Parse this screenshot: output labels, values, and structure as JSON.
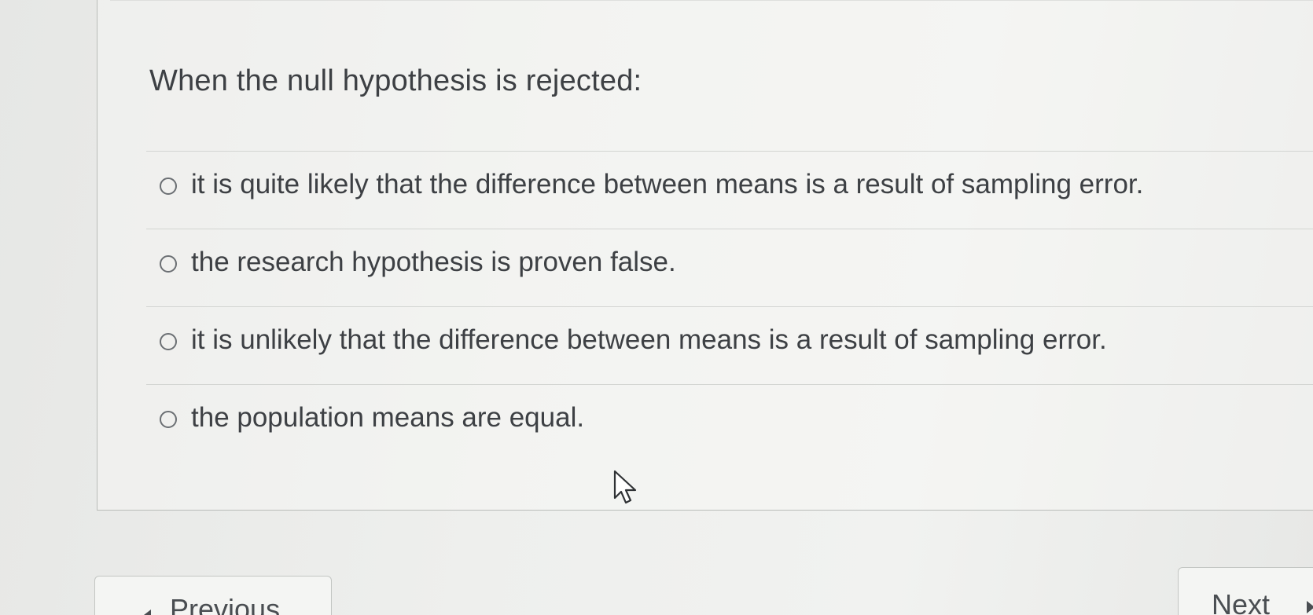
{
  "question": {
    "text": "When the null hypothesis is rejected:"
  },
  "options": [
    {
      "label": "it is quite likely that the difference between means is a result of sampling error.",
      "selected": false
    },
    {
      "label": "the research hypothesis is proven false.",
      "selected": false
    },
    {
      "label": "it is unlikely that the difference between means is a result of sampling error.",
      "selected": false
    },
    {
      "label": "the population means are equal.",
      "selected": false
    }
  ],
  "navigation": {
    "previous_label": "Previous",
    "next_label": "Next"
  },
  "icons": {
    "radio": "radio-button-icon",
    "cursor": "mouse-pointer-icon",
    "previous": "chevron-left-icon",
    "next": "chevron-right-icon"
  }
}
